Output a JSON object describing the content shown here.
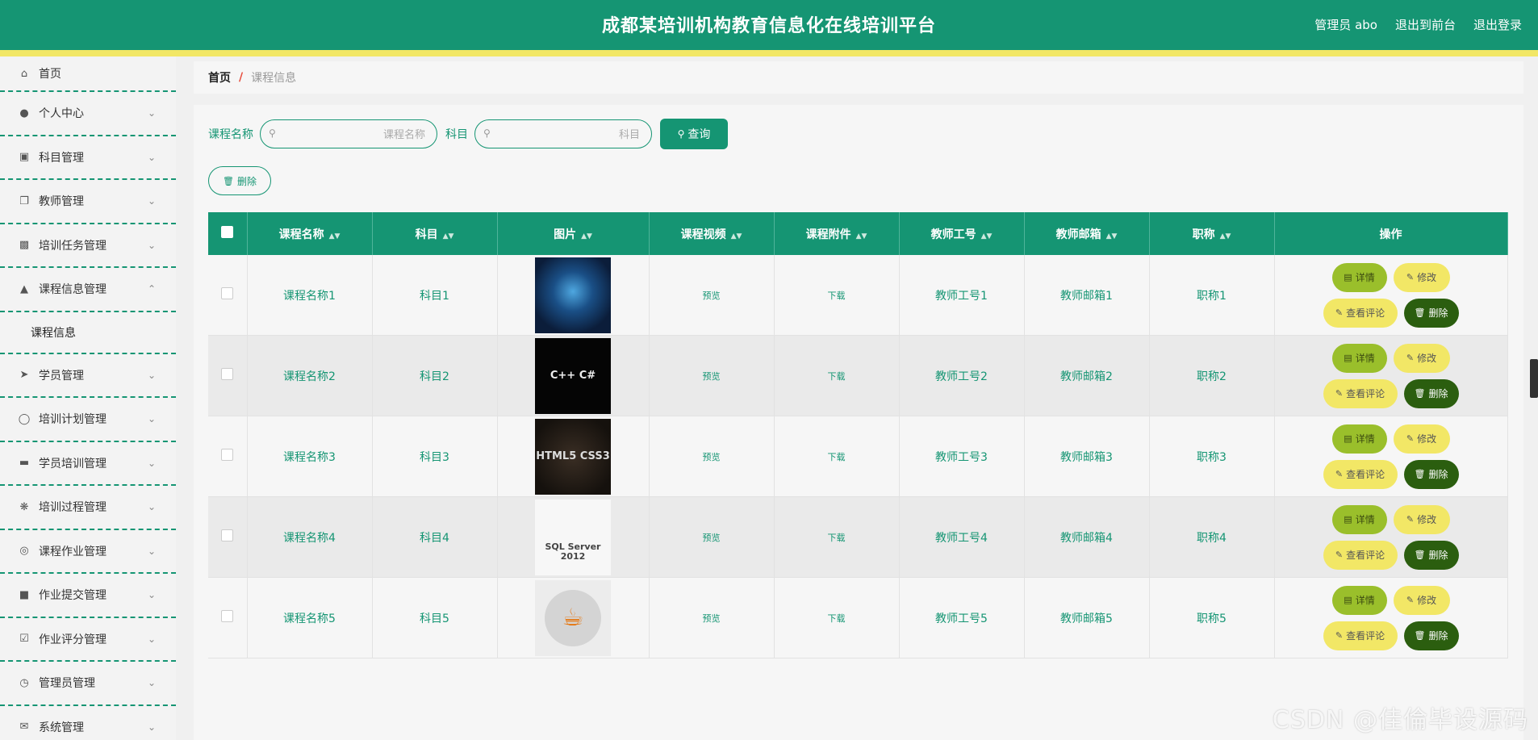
{
  "header": {
    "title": "成都某培训机构教育信息化在线培训平台",
    "admin_label": "管理员 abo",
    "front_label": "退出到前台",
    "logout_label": "退出登录"
  },
  "sidebar": {
    "items": [
      {
        "label": "首页",
        "icon": "home-icon"
      },
      {
        "label": "个人中心",
        "icon": "user-icon"
      },
      {
        "label": "科目管理",
        "icon": "clipboard-icon"
      },
      {
        "label": "教师管理",
        "icon": "copy-icon"
      },
      {
        "label": "培训任务管理",
        "icon": "monitor-icon"
      },
      {
        "label": "课程信息管理",
        "icon": "bell-icon"
      },
      {
        "label": "课程信息",
        "icon": ""
      },
      {
        "label": "学员管理",
        "icon": "send-icon"
      },
      {
        "label": "培训计划管理",
        "icon": "microphone-icon"
      },
      {
        "label": "学员培训管理",
        "icon": "ticket-icon"
      },
      {
        "label": "培训过程管理",
        "icon": "aperture-icon"
      },
      {
        "label": "课程作业管理",
        "icon": "lifebuoy-icon"
      },
      {
        "label": "作业提交管理",
        "icon": "brush-icon"
      },
      {
        "label": "作业评分管理",
        "icon": "check-clipboard-icon"
      },
      {
        "label": "管理员管理",
        "icon": "clock-icon"
      },
      {
        "label": "系统管理",
        "icon": "mail-icon"
      }
    ]
  },
  "breadcrumb": {
    "home": "首页",
    "sep": "/",
    "current": "课程信息"
  },
  "search": {
    "course_label": "课程名称",
    "course_placeholder": "课程名称",
    "subject_label": "科目",
    "subject_placeholder": "科目",
    "query_label": "查询",
    "delete_label": "删除"
  },
  "table": {
    "headers": [
      "课程名称",
      "科目",
      "图片",
      "课程视频",
      "课程附件",
      "教师工号",
      "教师邮箱",
      "职称",
      "操作"
    ],
    "preview_label": "预览",
    "download_label": "下载",
    "ops": {
      "detail": "详情",
      "edit": "修改",
      "review": "查看评论",
      "delete": "删除"
    },
    "rows": [
      {
        "name": "课程名称1",
        "subject": "科目1",
        "image_text": "",
        "teacher_no": "教师工号1",
        "email": "教师邮箱1",
        "title": "职称1"
      },
      {
        "name": "课程名称2",
        "subject": "科目2",
        "image_text": "C++ C#",
        "teacher_no": "教师工号2",
        "email": "教师邮箱2",
        "title": "职称2"
      },
      {
        "name": "课程名称3",
        "subject": "科目3",
        "image_text": "HTML5 CSS3",
        "teacher_no": "教师工号3",
        "email": "教师邮箱3",
        "title": "职称3"
      },
      {
        "name": "课程名称4",
        "subject": "科目4",
        "image_text": "SQL Server 2012",
        "teacher_no": "教师工号4",
        "email": "教师邮箱4",
        "title": "职称4"
      },
      {
        "name": "课程名称5",
        "subject": "科目5",
        "image_text": "",
        "teacher_no": "教师工号5",
        "email": "教师邮箱5",
        "title": "职称5"
      }
    ]
  },
  "watermark": "CSDN @佳倫毕设源码",
  "colors": {
    "primary": "#159573",
    "stripe": "#f2e766",
    "detail": "#9abf2b",
    "danger": "#2b5e0f"
  }
}
